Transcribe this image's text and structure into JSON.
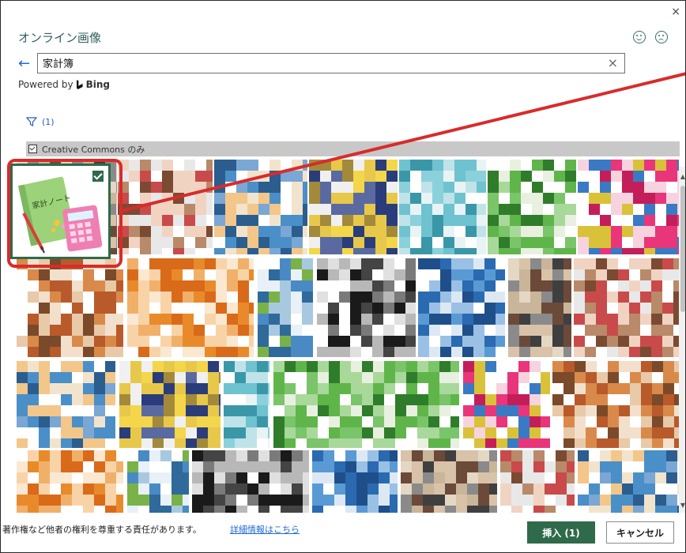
{
  "dialog": {
    "title": "オンライン画像",
    "close_glyph": "×",
    "feedback": [
      "smile-icon",
      "frown-icon"
    ]
  },
  "search": {
    "value": "家計簿",
    "back_glyph": "←",
    "clear_glyph": "×"
  },
  "powered": {
    "prefix": "Powered by",
    "brand": "Bing"
  },
  "filter": {
    "count_label": "(1)",
    "icon": "funnel-icon"
  },
  "license_filter": {
    "label": "Creative Commons のみ",
    "checked": true
  },
  "results": {
    "selected_index": 0,
    "selected_image_text": "家計ノート",
    "accent": "#2f6a4a",
    "highlight_color": "#d92b2b",
    "tile_count": 24
  },
  "footer": {
    "notice": "著作権など他者の権利を尊重する責任があります。",
    "link": "詳細情報はこちら",
    "insert_label": "挿入 (1)",
    "cancel_label": "キャンセル"
  }
}
